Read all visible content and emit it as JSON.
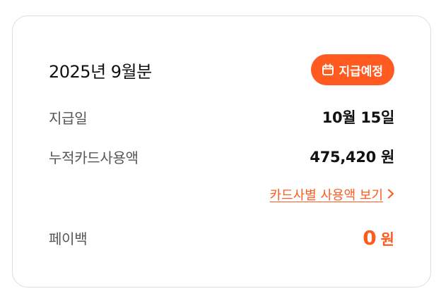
{
  "card": {
    "period": "2025년 9월분",
    "badge": {
      "label": "지급예정",
      "icon": "calendar-icon"
    },
    "payment_date": {
      "label": "지급일",
      "value": "10월 15일"
    },
    "card_usage": {
      "label": "누적카드사용액",
      "value": "475,420 원"
    },
    "usage_link": {
      "label": "카드사별 사용액 보기",
      "icon": "chevron-right-icon"
    },
    "payback": {
      "label": "페이백",
      "value": "0",
      "unit": "원"
    }
  },
  "colors": {
    "accent": "#ff5a1f",
    "text": "#111111",
    "label": "#555555",
    "border": "#dedede"
  }
}
